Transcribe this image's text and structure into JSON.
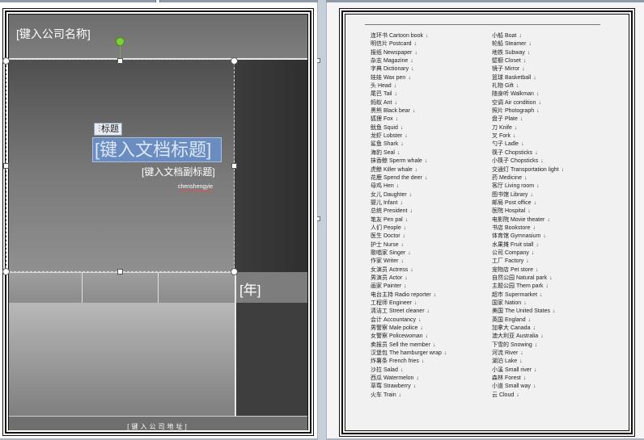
{
  "cover": {
    "company_name": "[键入公司名称]",
    "title_tag": "标题",
    "doc_title": "[键入文档标题]",
    "doc_subtitle": "[键入文档副标题]",
    "author": "chenshengyie",
    "year": "[年]",
    "company_address": "[键入公司地址]"
  },
  "word_list": {
    "left_column": [
      "连环书 Cartoon book",
      "明信片 Postcard",
      "报纸 Newspaper",
      "杂志 Magazine",
      "字典 Dictionary",
      "娃娃 Wax pen",
      "头 Head",
      "尾巴 Tail",
      "蚂蚁 Ant",
      "黑熊 Black bear",
      "狐狸 Fox",
      "鱿鱼 Squid",
      "龙虾 Lobster",
      "鲨鱼 Shark",
      "海豹 Seal",
      "抹香鲸 Sperm whale",
      "虎鲸 Killer whale",
      "花鹿 Spend the deer",
      "母鸡 Hen",
      "女儿 Daughter",
      "婴儿 Infant",
      "总统 President",
      "笔友 Pen pal",
      "人们 People",
      "医生 Doctor",
      "护士 Nurse",
      "歌唱家 Singer",
      "作家 Writer",
      "女演员 Actress",
      "男演员 Actor",
      "画家 Painter",
      "电台主持 Radio reporter",
      "工程师 Engineer",
      "清洁工 Street cleaner",
      "会计 Accountancy",
      "男警察 Male police",
      "女警察 Policewoman",
      "卖报员 Sell the member",
      "汉堡包 The hamburger wrap",
      "炸薯条 French fries",
      "沙拉 Salad",
      "西瓜 Watermelon",
      "草莓 Strawberry",
      "火车 Train"
    ],
    "right_column": [
      "小船 Boat",
      "轮船 Steamer",
      "地铁 Subway",
      "壁橱 Closet",
      "镜子 Mirror",
      "篮球 Basketball",
      "礼物 Gift",
      "随身听 Walkman",
      "空调 Air condition",
      "照片 Photograph",
      "盘子 Plate",
      "刀 Knife",
      "叉 Fork",
      "勺子 Ladle",
      "筷子 Chopsticks",
      "小筷子 Chopsticks",
      "交通灯 Transportation light",
      "药 Medicine",
      "客厅 Living room",
      "图书馆 Library",
      "邮局 Post office",
      "医院 Hospital",
      "电影院 Movie theater",
      "书店 Bookstore",
      "体育馆 Gymnasium",
      "水果摊 Fruit stall",
      "公司 Company",
      "工厂 Factory",
      "宠物店 Pet store",
      "自然公园 Natural park",
      "主题公园 Them park",
      "超市 Supermarket",
      "国家 Nation",
      "美国 The United States",
      "英国 England",
      "加拿大 Canada",
      "澳大利亚 Australia",
      "下雪的 Snowing",
      "河流 River",
      "湖泊 Lake",
      "小溪 Small river",
      "森林 Forest",
      "小道 Small way",
      "云 Cloud"
    ]
  }
}
